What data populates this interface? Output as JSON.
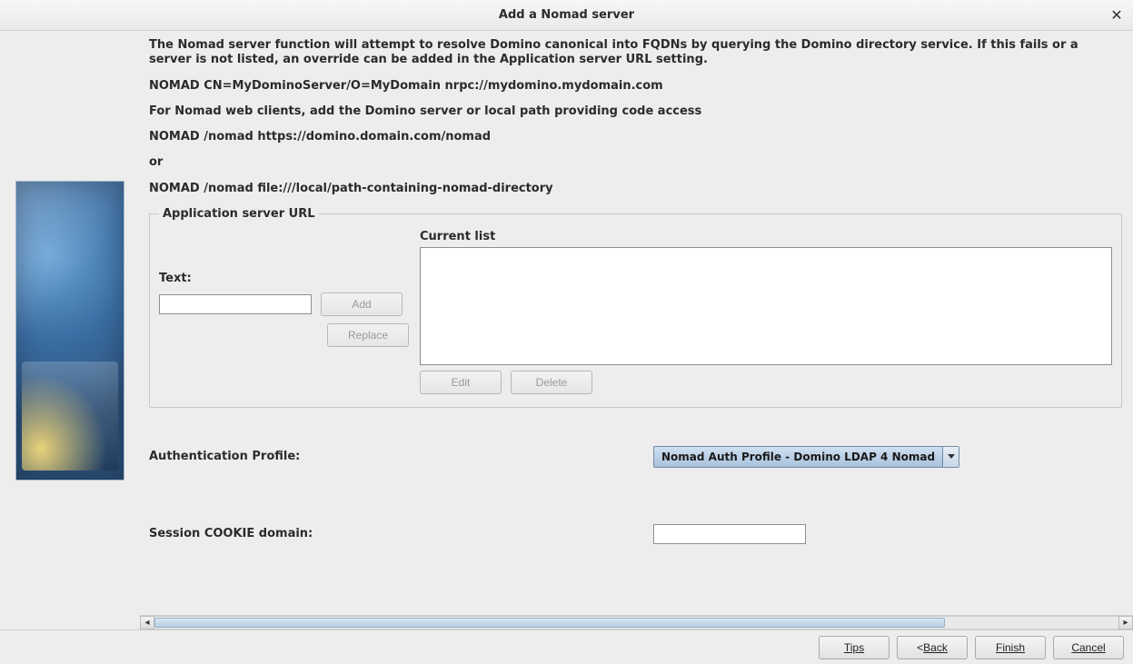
{
  "window": {
    "title": "Add a Nomad server"
  },
  "desc": {
    "p1": "The Nomad server function will attempt to resolve Domino canonical into FQDNs by querying the Domino directory service.  If this fails or a server is not listed, an override can be added in the Application server URL setting.",
    "p2": " NOMAD CN=MyDominoServer/O=MyDomain nrpc://mydomino.mydomain.com",
    "p3": "For Nomad web clients, add the Domino server or local path providing code access",
    "p4": " NOMAD /nomad https://domino.domain.com/nomad",
    "p5": "or",
    "p6": " NOMAD /nomad file:///local/path-containing-nomad-directory"
  },
  "group": {
    "legend": "Application server URL",
    "text_label": "Text:",
    "text_value": "",
    "add_label": "Add",
    "replace_label": "Replace",
    "current_list_label": "Current list",
    "edit_label": "Edit",
    "delete_label": "Delete",
    "list_items": []
  },
  "auth": {
    "label": "Authentication Profile:",
    "selected": "Nomad Auth Profile - Domino LDAP 4 Nomad"
  },
  "cookie": {
    "label": "Session COOKIE domain:",
    "value": ""
  },
  "footer": {
    "tips": "Tips",
    "back_prefix": "<",
    "back": "Back",
    "finish": "Finish",
    "cancel": "Cancel"
  }
}
